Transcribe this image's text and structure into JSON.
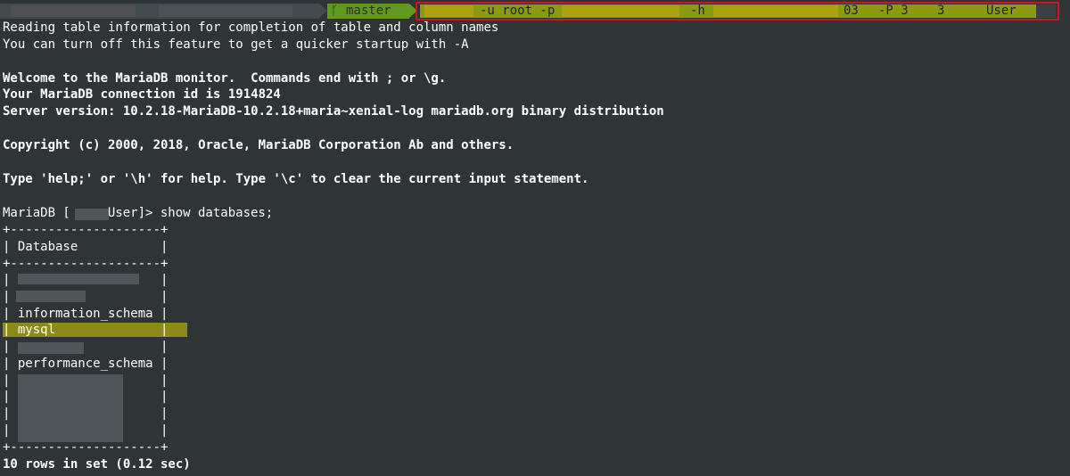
{
  "prompt": {
    "git_icon": "git-branch-icon",
    "branch": "master",
    "command_parts": {
      "user_flag": "-u root -p",
      "host_flag": "-h",
      "port_part": "03",
      "port_flag": "-P 3",
      "port_tail": "3",
      "db": "User"
    },
    "colors": {
      "git_segment": "#5f9a1e",
      "command_bg": "#8c9a12",
      "highlight_box": "#c8191e"
    }
  },
  "output": {
    "l1": "Reading table information for completion of table and column names",
    "l2": "You can turn off this feature to get a quicker startup with -A",
    "l3": "Welcome to the MariaDB monitor.  Commands end with ; or \\g.",
    "l4": "Your MariaDB connection id is 1914824",
    "l5": "Server version: 10.2.18-MariaDB-10.2.18+maria~xenial-log mariadb.org binary distribution",
    "l6": "Copyright (c) 2000, 2018, Oracle, MariaDB Corporation Ab and others.",
    "l7": "Type 'help;' or '\\h' for help. Type '\\c' to clear the current input statement.",
    "mariadb_prompt_pre": "MariaDB [",
    "mariadb_prompt_post": "User]> show databases;"
  },
  "table": {
    "border": "+--------------------+",
    "header": "| Database           |",
    "rows": [
      "|                    |",
      "|                    |",
      "| information_schema |",
      "| mysql              |",
      "|                    |",
      "| performance_schema |",
      "|                    |",
      "|                    |",
      "|                    |",
      "|                    |"
    ],
    "footer": "10 rows in set (0.12 sec)"
  }
}
